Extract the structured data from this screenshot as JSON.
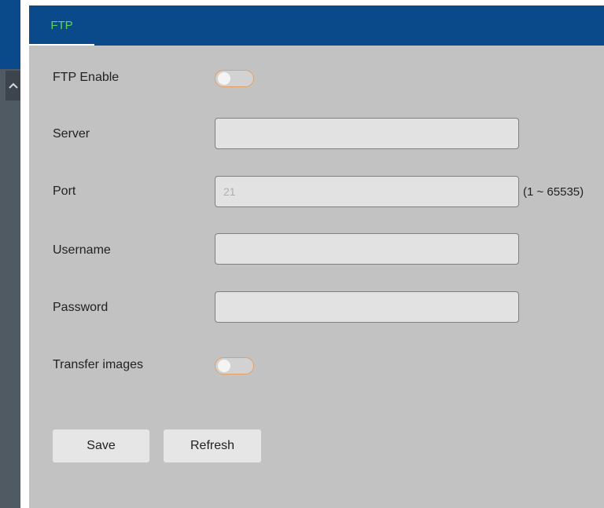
{
  "tab": {
    "label": "FTP"
  },
  "form": {
    "ftp_enable": {
      "label": "FTP Enable",
      "on": false
    },
    "server": {
      "label": "Server",
      "value": ""
    },
    "port": {
      "label": "Port",
      "value": "",
      "placeholder": "21",
      "range_hint": "(1 ~ 65535)"
    },
    "username": {
      "label": "Username",
      "value": ""
    },
    "password": {
      "label": "Password",
      "value": ""
    },
    "transfer_images": {
      "label": "Transfer images",
      "on": false
    }
  },
  "buttons": {
    "save": "Save",
    "refresh": "Refresh"
  },
  "colors": {
    "header": "#0b4a8a",
    "tab_text": "#5fd35f",
    "panel_bg": "#c2c2c2",
    "toggle_border": "#e4a060"
  },
  "icons": {
    "scroll_up": "chevron-up-icon"
  }
}
